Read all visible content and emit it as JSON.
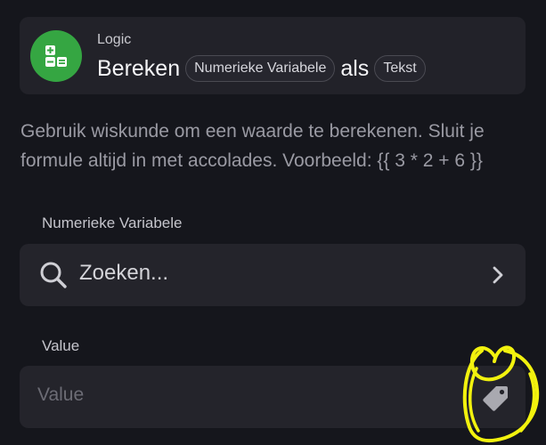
{
  "header": {
    "category": "Logic",
    "title_prefix": "Bereken",
    "pill_variable": "Numerieke Variabele",
    "title_connector": "als",
    "pill_type": "Tekst",
    "icon": "calculator-icon"
  },
  "description": "Gebruik wiskunde om een waarde te berekenen. Sluit je formule altijd in met accolades. Voorbeeld: {{ 3 * 2 + 6 }}",
  "variable_field": {
    "label": "Numerieke Variabele",
    "search_text": "Zoeken...",
    "icons": [
      "search-icon",
      "chevron-right-icon"
    ]
  },
  "value_field": {
    "label": "Value",
    "placeholder": "Value",
    "icon": "tag-icon"
  },
  "colors": {
    "background": "#15161c",
    "card": "#222229",
    "accent_green": "#35a642",
    "annotation_yellow": "#f2f20e"
  }
}
